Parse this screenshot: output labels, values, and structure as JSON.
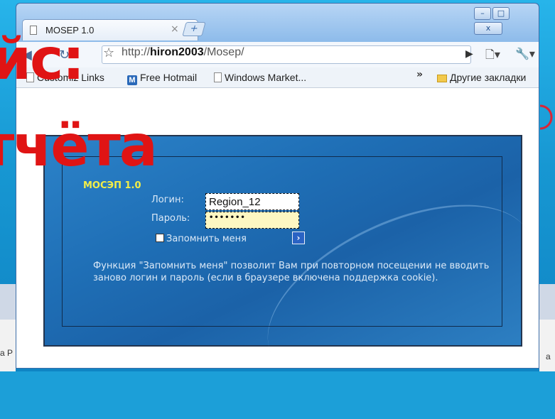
{
  "browser": {
    "tab_title": "MOSEP 1.0",
    "tab_close": "×",
    "new_tab": "+",
    "window_controls": {
      "minimize": "–",
      "maximize": "□",
      "close": "x"
    },
    "url_prefix": "http://",
    "url_host": "hiron2003",
    "url_path": "/Mosep/",
    "go_icon": "▶",
    "page_menu": "🗋▾",
    "tools_menu": "🔧▾"
  },
  "bookmarks": {
    "items": [
      {
        "label": "Customiz Links",
        "icon": "page-icon"
      },
      {
        "label": "Free Hotmail",
        "icon": "hotmail-icon"
      },
      {
        "label": "Windows Market...",
        "icon": "page-icon"
      }
    ],
    "overflow": "»",
    "other": "Другие закладки"
  },
  "login": {
    "app_title": "МОСЭП 1.0",
    "login_label": "Логин:",
    "login_value": "Region_12",
    "password_label": "Пароль:",
    "password_value": "•••••••",
    "remember_label": "Запомнить меня",
    "submit_icon": "›",
    "description": "Функция \"Запомнить меня\" позволит Вам при повторном посещении не вводить заново логин и пароль (если в браузере включена поддержка cookie)."
  },
  "overlay": {
    "line1": "йс:",
    "line2": "тчёта"
  },
  "background": {
    "left_text": "а Р",
    "right_text": "а"
  },
  "colors": {
    "slide_bg": "#1c9fd8",
    "overlay_text": "#e01414",
    "app_title": "#f3ee47",
    "login_panel": "#1f6fb6"
  }
}
